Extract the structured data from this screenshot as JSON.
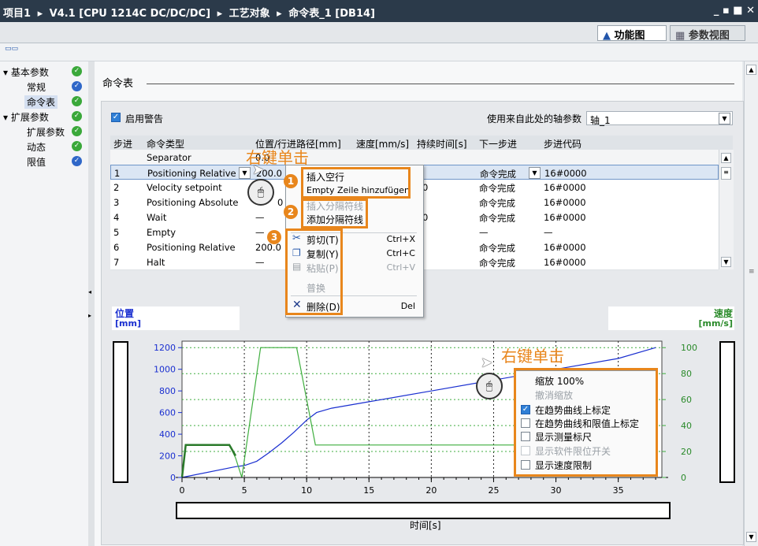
{
  "titlebar": {
    "breadcrumb": [
      "项目1",
      "V4.1 [CPU 1214C DC/DC/DC]",
      "工艺对象",
      "命令表_1 [DB14]"
    ],
    "window_controls": "_ ▪ ■ ✕"
  },
  "view_tabs": {
    "function_view": "功能图",
    "param_view": "参数视图"
  },
  "nav": {
    "items": [
      {
        "label": "基本参数",
        "status": "green"
      },
      {
        "label": "常规",
        "status": "blue"
      },
      {
        "label": "命令表",
        "status": "green"
      },
      {
        "label": "扩展参数",
        "status": "green"
      },
      {
        "label": "扩展参数",
        "status": "green"
      },
      {
        "label": "动态",
        "status": "green"
      },
      {
        "label": "限值",
        "status": "blue"
      }
    ]
  },
  "section": {
    "title": "命令表"
  },
  "options": {
    "enable_warning_label": "启用警告",
    "enable_warning_checked": true,
    "axis_param_label": "使用来自此处的轴参数",
    "axis_value": "轴_1"
  },
  "table": {
    "headers": [
      "步进",
      "命令类型",
      "位置/行进路径[mm]",
      "速度[mm/s]",
      "持续时间[s]",
      "下一步进",
      "步进代码"
    ],
    "rows": [
      {
        "step": "",
        "type": "Separator",
        "pos": "0.0",
        "speed": "",
        "duration": "",
        "next": "",
        "code": ""
      },
      {
        "step": "1",
        "type": "Positioning Relative",
        "pos": "200.0",
        "speed": "",
        "duration": "",
        "next": "命令完成",
        "code": "16#0000"
      },
      {
        "step": "2",
        "type": "Velocity setpoint",
        "pos": "",
        "speed": "",
        "duration": "0",
        "next": "命令完成",
        "code": "16#0000"
      },
      {
        "step": "3",
        "type": "Positioning Absolute",
        "pos": "0",
        "speed": "",
        "duration": "",
        "next": "命令完成",
        "code": "16#0000"
      },
      {
        "step": "4",
        "type": "Wait",
        "pos": "—",
        "speed": "",
        "duration": "0",
        "next": "命令完成",
        "code": "16#0000"
      },
      {
        "step": "5",
        "type": "Empty",
        "pos": "—",
        "speed": "",
        "duration": "",
        "next": "—",
        "code": "—"
      },
      {
        "step": "6",
        "type": "Positioning Relative",
        "pos": "200.0",
        "speed": "",
        "duration": "",
        "next": "命令完成",
        "code": "16#0000"
      },
      {
        "step": "7",
        "type": "Halt",
        "pos": "—",
        "speed": "",
        "duration": "",
        "next": "命令完成",
        "code": "16#0000"
      }
    ]
  },
  "context_menu_table": {
    "callout": "右键单击",
    "items": [
      {
        "label": "插入空行",
        "shortcut": "",
        "disabled": false,
        "icon": ""
      },
      {
        "label": "Empty Zeile hinzufügen",
        "shortcut": "",
        "disabled": false,
        "icon": ""
      },
      {
        "label": "插入分隔符线",
        "shortcut": "",
        "disabled": true,
        "icon": ""
      },
      {
        "label": "添加分隔符线",
        "shortcut": "",
        "disabled": false,
        "icon": ""
      },
      {
        "label": "剪切(T)",
        "shortcut": "Ctrl+X",
        "disabled": false,
        "icon": "scissors-icon"
      },
      {
        "label": "复制(Y)",
        "shortcut": "Ctrl+C",
        "disabled": false,
        "icon": "copy-icon"
      },
      {
        "label": "粘贴(P)",
        "shortcut": "Ctrl+V",
        "disabled": true,
        "icon": "paste-icon"
      },
      {
        "label": "普换",
        "shortcut": "",
        "disabled": true,
        "icon": ""
      },
      {
        "label": "删除(D)",
        "shortcut": "Del",
        "disabled": false,
        "icon": "delete-x-icon"
      }
    ],
    "badges": [
      "1",
      "2",
      "3"
    ]
  },
  "chart_labels": {
    "position": "位置",
    "position_unit": "[mm]",
    "speed": "速度",
    "speed_unit": "[mm/s]",
    "x_axis": "时间[s]"
  },
  "context_menu_chart": {
    "callout": "右键单击",
    "items": [
      {
        "label": "缩放 100%",
        "checkbox": false,
        "checked": false,
        "disabled": false
      },
      {
        "label": "撤消缩放",
        "checkbox": false,
        "checked": false,
        "disabled": true
      },
      {
        "label": "在趋势曲线上标定",
        "checkbox": true,
        "checked": true,
        "disabled": false
      },
      {
        "label": "在趋势曲线和限值上标定",
        "checkbox": true,
        "checked": false,
        "disabled": false
      },
      {
        "label": "显示测量标尺",
        "checkbox": true,
        "checked": false,
        "disabled": false
      },
      {
        "label": "显示软件限位开关",
        "checkbox": true,
        "checked": false,
        "disabled": true
      },
      {
        "label": "显示速度限制",
        "checkbox": true,
        "checked": false,
        "disabled": false
      }
    ]
  },
  "chart_data": {
    "type": "line",
    "xlabel": "时间[s]",
    "ylabel_left": "位置 [mm]",
    "ylabel_right": "速度 [mm/s]",
    "xlim": [
      0,
      38.5
    ],
    "ylim_left": [
      0,
      1300
    ],
    "ylim_right": [
      0,
      105
    ],
    "x_ticks": [
      0,
      5,
      10,
      15,
      20,
      25,
      30,
      35
    ],
    "y_ticks_left": [
      0,
      200,
      400,
      600,
      800,
      1000,
      1200
    ],
    "y_ticks_right": [
      0,
      20,
      40,
      60,
      80,
      100
    ],
    "series": [
      {
        "axis": "left",
        "color": "#1a2fd0",
        "x": [
          0,
          4.3,
          5,
          6,
          7,
          8,
          9,
          10,
          10.8,
          12,
          15,
          20,
          25,
          30,
          35,
          38
        ],
        "y": [
          0,
          100,
          110,
          150,
          230,
          320,
          420,
          530,
          600,
          640,
          700,
          800,
          900,
          1000,
          1100,
          1200
        ]
      },
      {
        "axis": "right",
        "color": "#3fae3f",
        "x": [
          0,
          0.3,
          3.8,
          4.3,
          4.8,
          6.3,
          9.2,
          10.7,
          11,
          37.3,
          38
        ],
        "y": [
          0,
          25,
          25,
          15,
          0,
          100,
          100,
          25,
          25,
          25,
          0
        ]
      },
      {
        "axis": "left",
        "color": "#2a7a2a",
        "x": [
          0,
          0.3,
          3.8,
          4.3
        ],
        "y": [
          0,
          300,
          300,
          200
        ]
      }
    ]
  }
}
